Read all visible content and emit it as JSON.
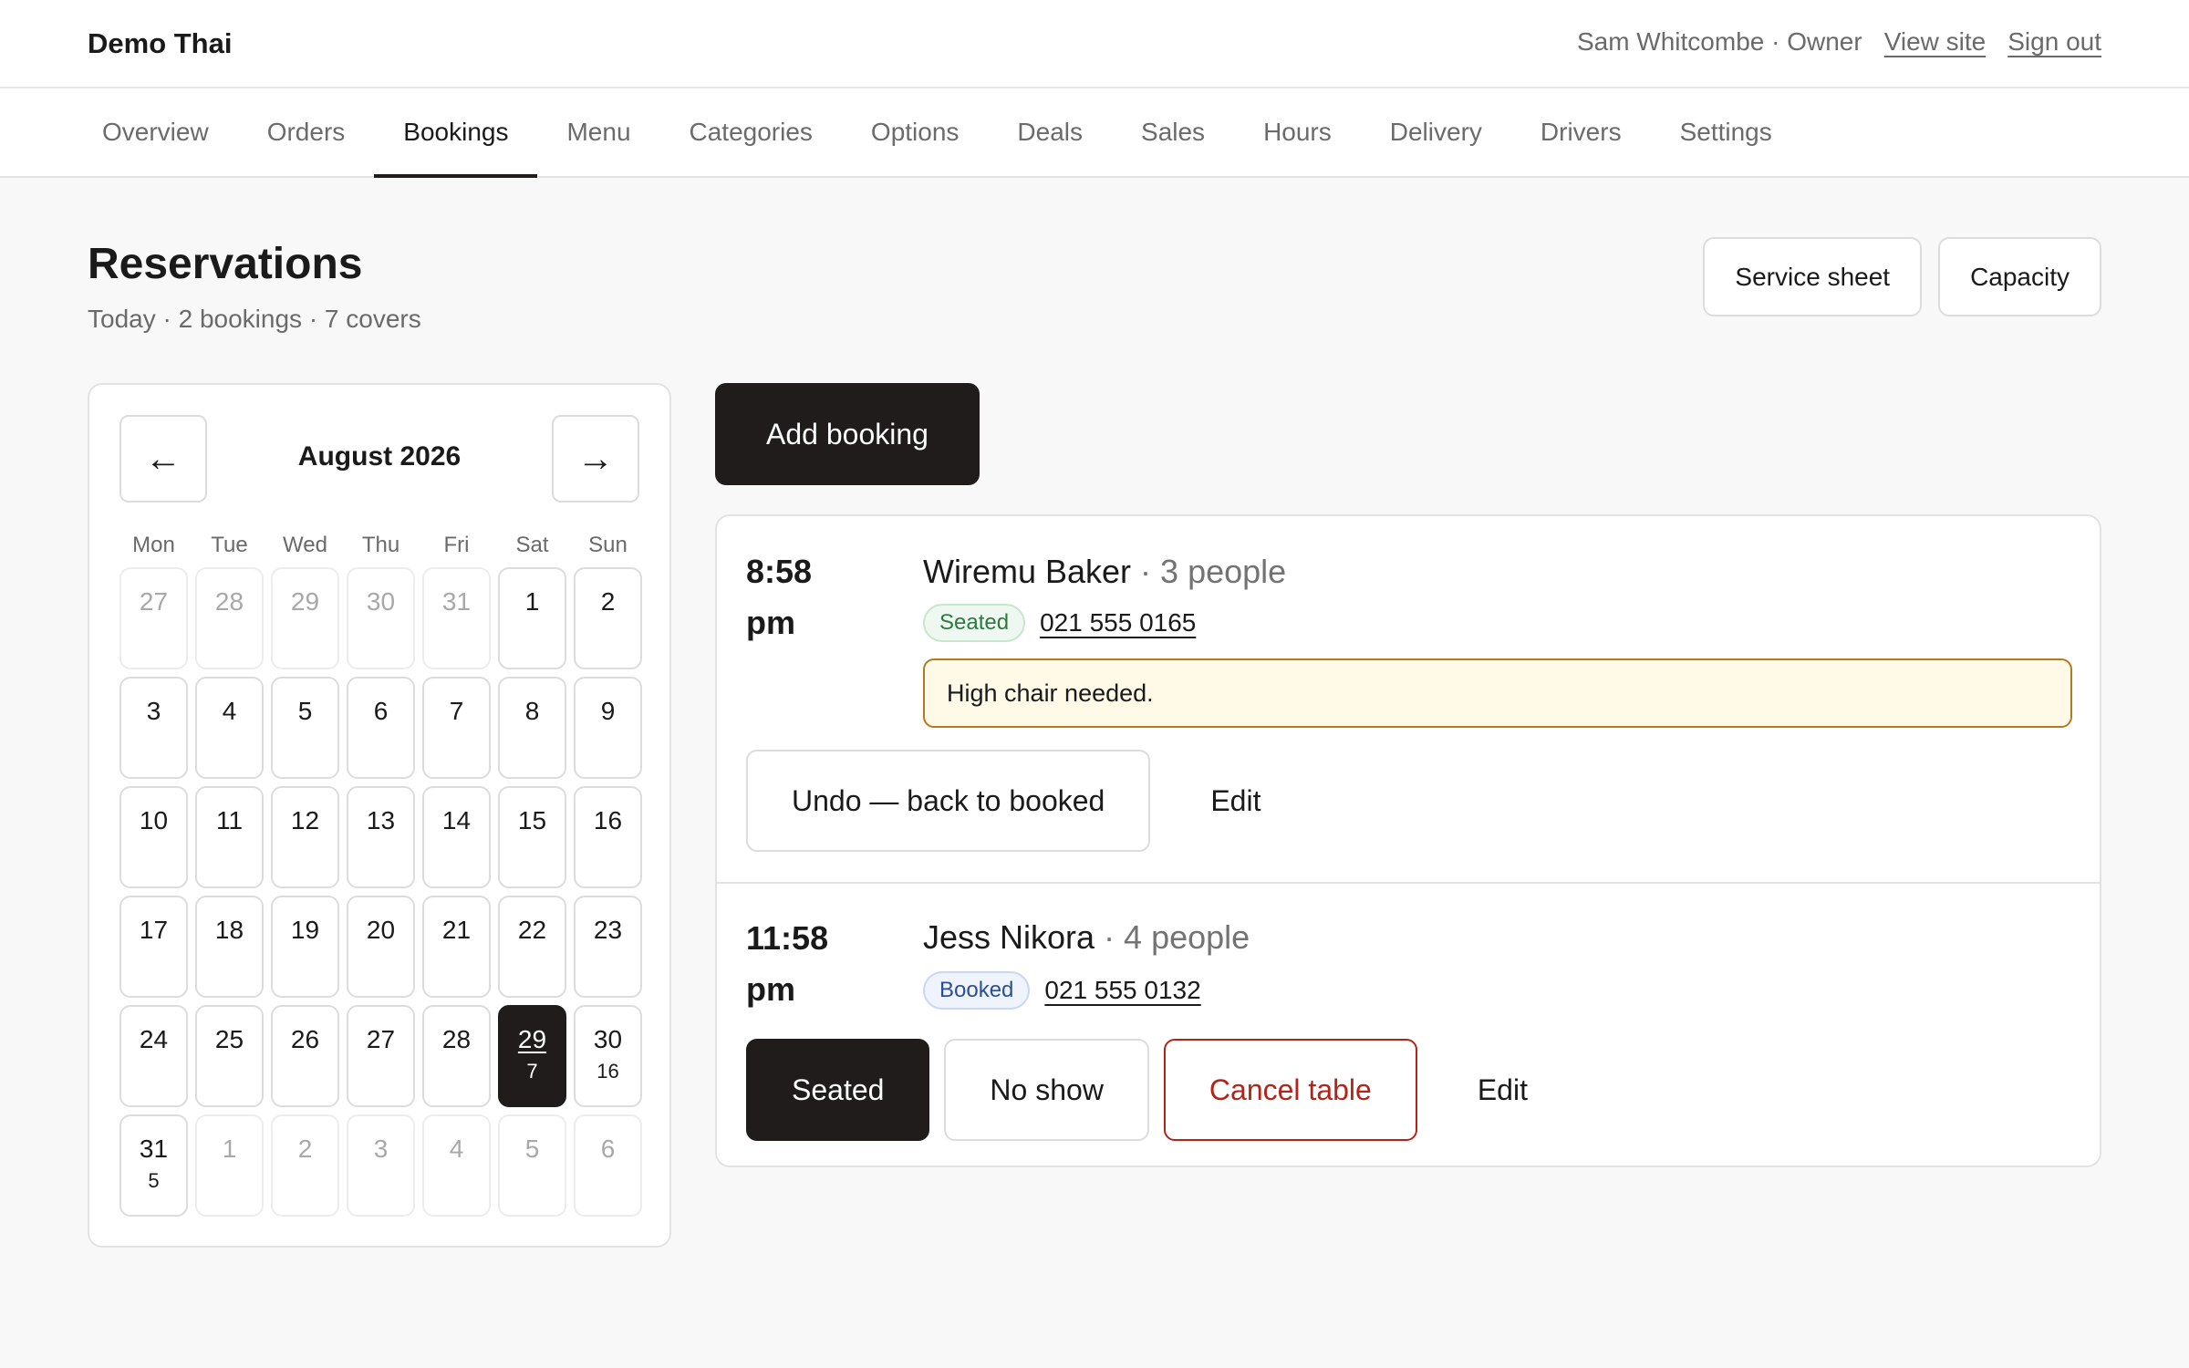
{
  "app": {
    "brand": "Demo Thai",
    "user": "Sam Whitcombe · Owner",
    "view_site": "View site",
    "sign_out": "Sign out"
  },
  "nav": {
    "tabs": [
      {
        "label": "Overview"
      },
      {
        "label": "Orders"
      },
      {
        "label": "Bookings",
        "active": true
      },
      {
        "label": "Menu"
      },
      {
        "label": "Categories"
      },
      {
        "label": "Options"
      },
      {
        "label": "Deals"
      },
      {
        "label": "Sales"
      },
      {
        "label": "Hours"
      },
      {
        "label": "Delivery"
      },
      {
        "label": "Drivers"
      },
      {
        "label": "Settings"
      }
    ]
  },
  "page": {
    "title": "Reservations",
    "subtitle": "Today · 2 bookings · 7 covers",
    "service_sheet": "Service sheet",
    "capacity": "Capacity",
    "add_booking": "Add booking"
  },
  "calendar": {
    "prev": "←",
    "next": "→",
    "month": "August 2026",
    "weekdays": [
      "Mon",
      "Tue",
      "Wed",
      "Thu",
      "Fri",
      "Sat",
      "Sun"
    ],
    "days": [
      {
        "n": "27",
        "muted": true
      },
      {
        "n": "28",
        "muted": true
      },
      {
        "n": "29",
        "muted": true
      },
      {
        "n": "30",
        "muted": true
      },
      {
        "n": "31",
        "muted": true
      },
      {
        "n": "1"
      },
      {
        "n": "2"
      },
      {
        "n": "3"
      },
      {
        "n": "4"
      },
      {
        "n": "5"
      },
      {
        "n": "6"
      },
      {
        "n": "7"
      },
      {
        "n": "8"
      },
      {
        "n": "9"
      },
      {
        "n": "10"
      },
      {
        "n": "11"
      },
      {
        "n": "12"
      },
      {
        "n": "13"
      },
      {
        "n": "14"
      },
      {
        "n": "15"
      },
      {
        "n": "16"
      },
      {
        "n": "17"
      },
      {
        "n": "18"
      },
      {
        "n": "19"
      },
      {
        "n": "20"
      },
      {
        "n": "21"
      },
      {
        "n": "22"
      },
      {
        "n": "23"
      },
      {
        "n": "24"
      },
      {
        "n": "25"
      },
      {
        "n": "26"
      },
      {
        "n": "27"
      },
      {
        "n": "28"
      },
      {
        "n": "29",
        "covers": "7",
        "selected": true
      },
      {
        "n": "30",
        "covers": "16"
      },
      {
        "n": "31",
        "covers": "5"
      },
      {
        "n": "1",
        "muted": true
      },
      {
        "n": "2",
        "muted": true
      },
      {
        "n": "3",
        "muted": true
      },
      {
        "n": "4",
        "muted": true
      },
      {
        "n": "5",
        "muted": true
      },
      {
        "n": "6",
        "muted": true
      }
    ]
  },
  "bookings": [
    {
      "time": "8:58 pm",
      "name": "Wiremu Baker",
      "people": " · 3 people",
      "status": "Seated",
      "phone": "021 555 0165",
      "note": "High chair needed.",
      "actions": {
        "undo": "Undo — back to booked",
        "edit": "Edit"
      }
    },
    {
      "time": "11:58 pm",
      "name": "Jess Nikora",
      "people": " · 4 people",
      "status": "Booked",
      "phone": "021 555 0132",
      "actions": {
        "seated": "Seated",
        "no_show": "No show",
        "cancel": "Cancel table",
        "edit": "Edit"
      }
    }
  ],
  "colors": {
    "primary": "#1f1c1b",
    "danger": "#b42318",
    "note_bg": "#fff9e8",
    "note_border": "#b7791f",
    "seated_badge": "#2c7a41",
    "booked_badge": "#2b4f96"
  }
}
